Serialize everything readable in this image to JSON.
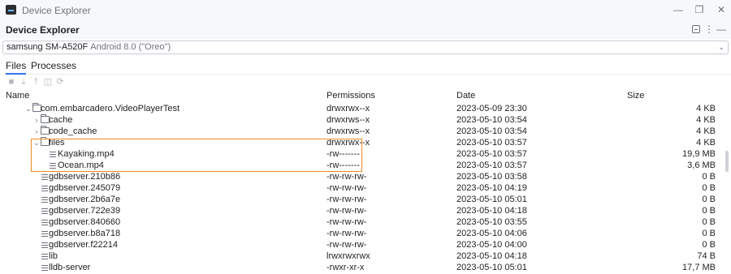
{
  "window": {
    "title": "Device Explorer"
  },
  "tool_window": {
    "title": "Device Explorer"
  },
  "device": {
    "name": "samsung SM-A520F",
    "os": "Android 8.0 (\"Oreo\")"
  },
  "tabs": [
    {
      "label": "Files",
      "active": true
    },
    {
      "label": "Processes",
      "active": false
    }
  ],
  "columns": {
    "name": "Name",
    "permissions": "Permissions",
    "date": "Date",
    "size": "Size"
  },
  "rows": [
    {
      "name": "com.embarcadero.VideoPlayerTest",
      "type": "folder",
      "expanded": true,
      "depth": 0,
      "permissions": "drwxrwx--x",
      "date": "2023-05-09 23:30",
      "size": "4 KB"
    },
    {
      "name": "cache",
      "type": "folder",
      "expanded": false,
      "depth": 1,
      "permissions": "drwxrws--x",
      "date": "2023-05-10 03:54",
      "size": "4 KB"
    },
    {
      "name": "code_cache",
      "type": "folder",
      "expanded": false,
      "depth": 1,
      "permissions": "drwxrws--x",
      "date": "2023-05-10 03:54",
      "size": "4 KB"
    },
    {
      "name": "files",
      "type": "folder",
      "expanded": true,
      "depth": 1,
      "permissions": "drwxrwx--x",
      "date": "2023-05-10 03:57",
      "size": "4 KB"
    },
    {
      "name": "Kayaking.mp4",
      "type": "file",
      "depth": 2,
      "permissions": "-rw-------",
      "date": "2023-05-10 03:57",
      "size": "19,9 MB"
    },
    {
      "name": "Ocean.mp4",
      "type": "file",
      "depth": 2,
      "permissions": "-rw-------",
      "date": "2023-05-10 03:57",
      "size": "3,6 MB"
    },
    {
      "name": "gdbserver.210b86",
      "type": "file",
      "depth": 1,
      "permissions": "-rw-rw-rw-",
      "date": "2023-05-10 03:58",
      "size": "0 B"
    },
    {
      "name": "gdbserver.245079",
      "type": "file",
      "depth": 1,
      "permissions": "-rw-rw-rw-",
      "date": "2023-05-10 04:19",
      "size": "0 B"
    },
    {
      "name": "gdbserver.2b6a7e",
      "type": "file",
      "depth": 1,
      "permissions": "-rw-rw-rw-",
      "date": "2023-05-10 05:01",
      "size": "0 B"
    },
    {
      "name": "gdbserver.722e39",
      "type": "file",
      "depth": 1,
      "permissions": "-rw-rw-rw-",
      "date": "2023-05-10 04:18",
      "size": "0 B"
    },
    {
      "name": "gdbserver.840660",
      "type": "file",
      "depth": 1,
      "permissions": "-rw-rw-rw-",
      "date": "2023-05-10 03:55",
      "size": "0 B"
    },
    {
      "name": "gdbserver.b8a718",
      "type": "file",
      "depth": 1,
      "permissions": "-rw-rw-rw-",
      "date": "2023-05-10 04:06",
      "size": "0 B"
    },
    {
      "name": "gdbserver.f22214",
      "type": "file",
      "depth": 1,
      "permissions": "-rw-rw-rw-",
      "date": "2023-05-10 04:00",
      "size": "0 B"
    },
    {
      "name": "lib",
      "type": "file",
      "depth": 1,
      "permissions": "lrwxrwxrwx",
      "date": "2023-05-10 04:18",
      "size": "74 B"
    },
    {
      "name": "lldb-server",
      "type": "file",
      "depth": 1,
      "permissions": "-rwxr-xr-x",
      "date": "2023-05-10 05:01",
      "size": "17,7 MB"
    }
  ],
  "colors": {
    "accent": "#3574f0",
    "highlight": "#f08a24"
  },
  "icons": {
    "toolbar": [
      "new-folder-icon",
      "download-icon",
      "upload-icon",
      "delete-icon",
      "refresh-icon"
    ]
  }
}
